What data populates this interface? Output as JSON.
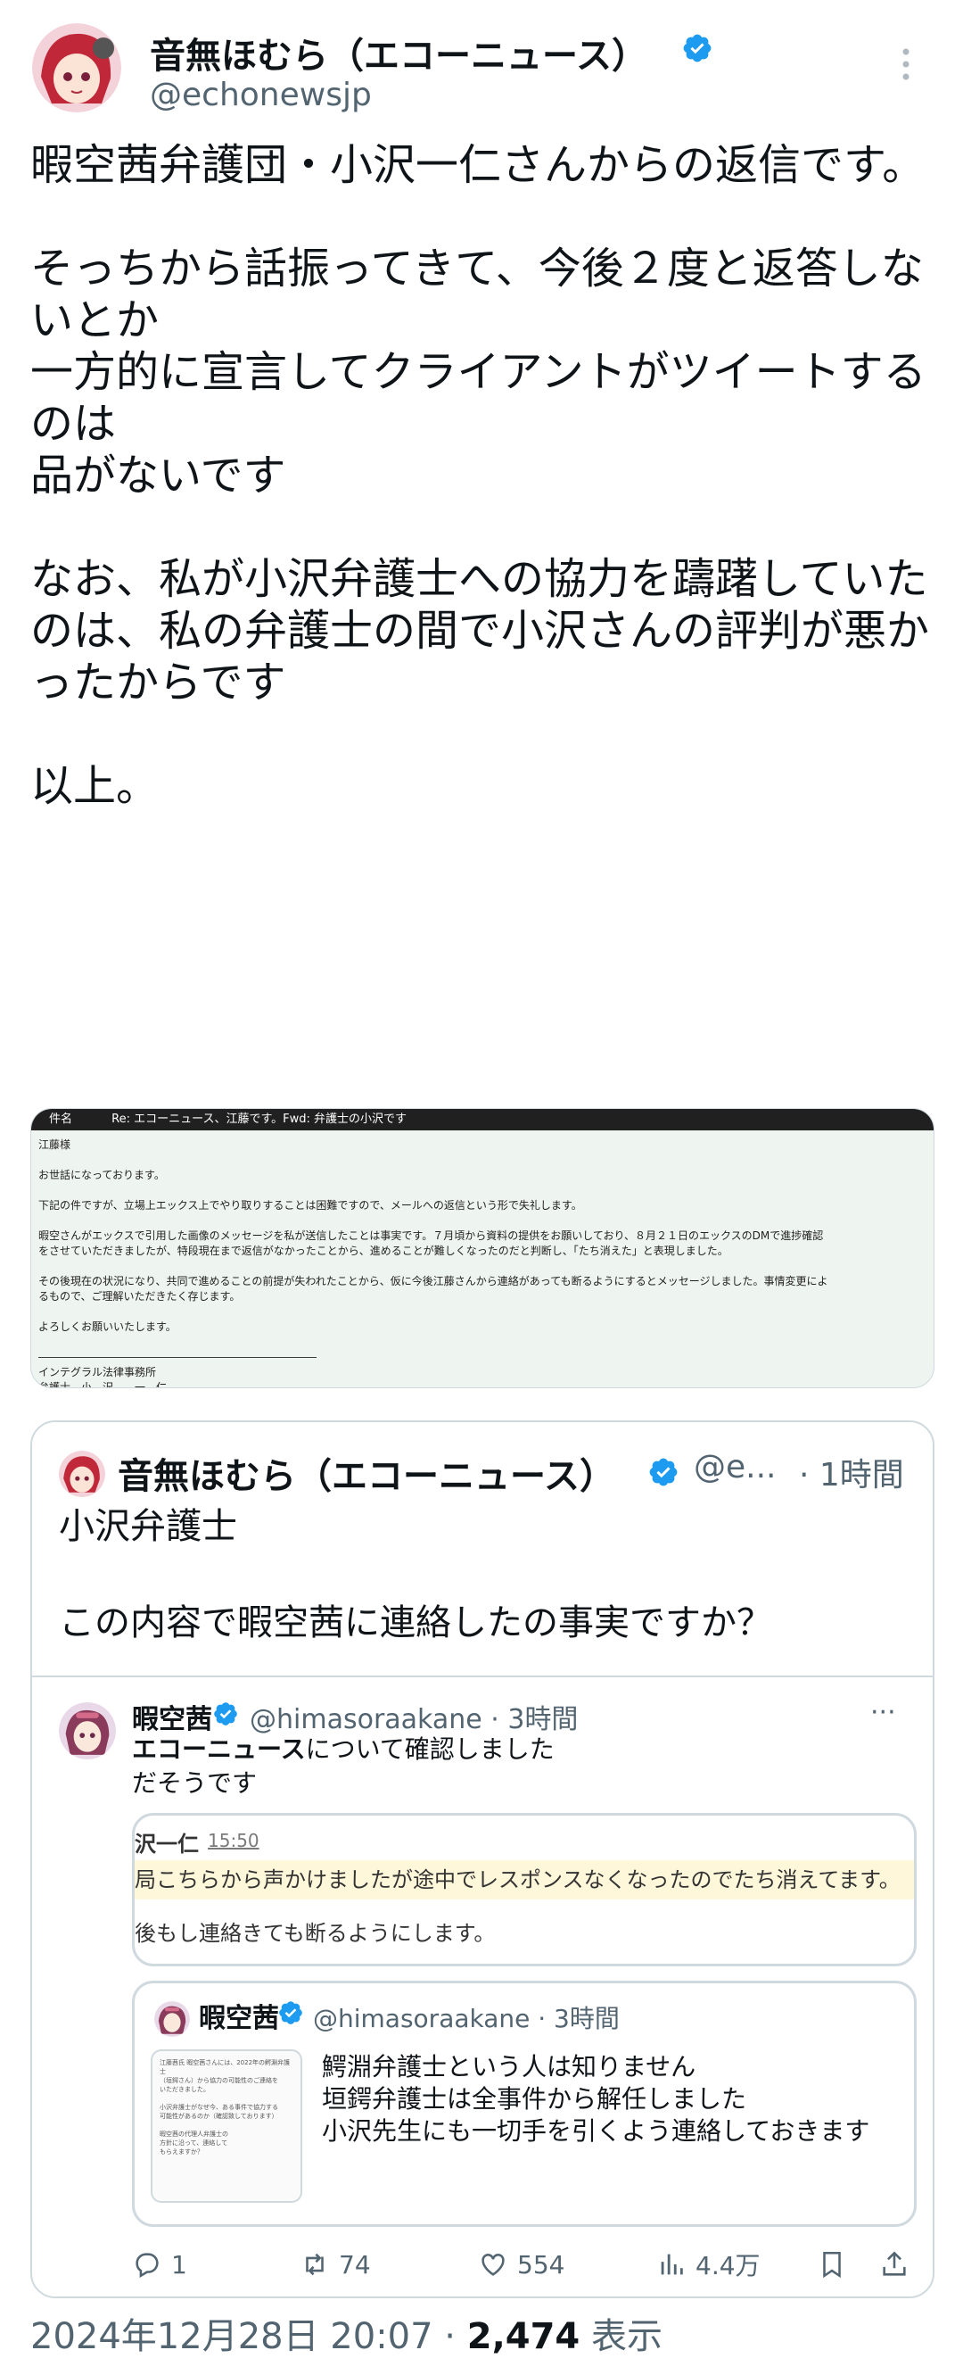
{
  "author": {
    "name": "音無ほむら（エコーニュース）",
    "handle": "@echonewsjp"
  },
  "tweet": {
    "text": "暇空茜弁護団・小沢一仁さんからの返信です。\n\nそっちから話振ってきて、今後２度と返答しないとか\n一方的に宣言してクライアントがツイートするのは\n品がないです\n\nなお、私が小沢弁護士への協力を躊躇していたのは、私の弁護士の間で小沢さんの評判が悪かったからです\n\n以上。"
  },
  "email": {
    "subject": "Re: エコーニュース、江藤です。Fwd: 弁護士の小沢です",
    "subject_prefix": "件名",
    "body": "江藤様\n\nお世話になっております。\n\n下記の件ですが、立場上エックス上でやり取りすることは困難ですので、メールへの返信という形で失礼します。\n\n暇空さんがエックスで引用した画像のメッセージを私が送信したことは事実です。７月頃から資料の提供をお願いしており、８月２１日のエックスのDMで進捗確認\nをさせていただきましたが、特段現在まで返信がなかったことから、進めることが難しくなったのだと判断し、「たち消えた」と表現しました。\n\nその後現在の状況になり、共同で進めることの前提が失われたことから、仮に今後江藤さんから連絡があっても断るようにするとメッセージしました。事情変更によ\nるもので、ご理解いただきたく存じます。\n\nよろしくお願いいたします。\n\n――――――――――――――――――――――――――\nインテグラル法律事務所\n弁護士　小　沢　　一　仁"
  },
  "quote": {
    "name": "音無ほむら（エコーニュース）",
    "handle": "@e...",
    "time": "· 1時間",
    "text": "小沢弁護士\n\nこの内容で暇空茜に連絡したの事実ですか？"
  },
  "inner": {
    "name": "暇空茜",
    "handle": "@himasoraakane · 3時間",
    "more": "···",
    "text_bold": "エコーニュース",
    "text_rest": "について確認しました",
    "text_line2": "だそうです",
    "chat": {
      "name": "沢一仁",
      "time": "15:50",
      "line1": "局こちらから声かけましたが途中でレスポンスなくなったのでたち消えてます。",
      "line2": "後もし連絡きても断るようにします。"
    }
  },
  "nested": {
    "name": "暇空茜",
    "handle": "@himasoraakane · 3時間",
    "text": "鰐淵弁護士という人は知りません\n垣鍔弁護士は全事件から解任しました\n小沢先生にも一切手を引くよう連絡しておきます",
    "thumb_text": "江藤茜氏 暇空茜さんには、2022年の鰐淵弁護士\n（垣鍔さん）から協力の可能性のご連絡を\nいただきました。\n\n小沢弁護士がなぜ今、ある事件で協力する\n可能性があるのか（確認致しております）\n\n暇空茜の代理人弁護士の\n方針に沿って、連絡して\nもらえますか？\n\n\n\n\n\n\n\n\n"
  },
  "actions": {
    "replies": "1",
    "retweets": "74",
    "likes": "554",
    "views": "4.4万"
  },
  "footer": {
    "timestamp": "2024年12月28日 20:07 · ",
    "views_count": "2,474",
    "views_label": " 表示"
  },
  "colors": {
    "verified": "#1d9bf0",
    "secondary_text": "#536471",
    "border": "#cfd9de",
    "chat_highlight": "#fff7d9"
  }
}
